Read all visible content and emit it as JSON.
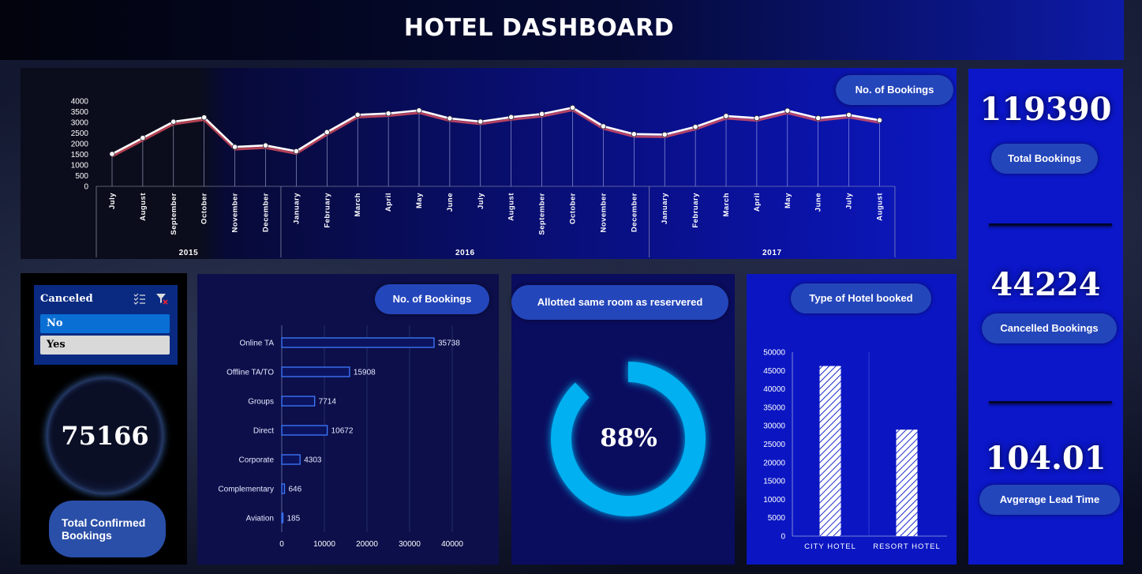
{
  "header": {
    "title": "HOTEL DASHBOARD"
  },
  "line_chart": {
    "pill": "No. of Bookings",
    "chart_data": {
      "type": "line",
      "categories": [
        "July",
        "August",
        "September",
        "October",
        "November",
        "December",
        "January",
        "February",
        "March",
        "April",
        "May",
        "June",
        "July",
        "August",
        "September",
        "October",
        "November",
        "December",
        "January",
        "February",
        "March",
        "April",
        "May",
        "June",
        "July",
        "August"
      ],
      "year_groups": [
        {
          "label": "2015",
          "count": 6
        },
        {
          "label": "2016",
          "count": 12
        },
        {
          "label": "2017",
          "count": 8
        }
      ],
      "values": [
        1517,
        2273,
        3030,
        3232,
        1850,
        1919,
        1648,
        2540,
        3354,
        3419,
        3561,
        3187,
        3037,
        3247,
        3394,
        3690,
        2818,
        2450,
        2430,
        2790,
        3300,
        3200,
        3550,
        3200,
        3350,
        3100
      ],
      "yticks": [
        0,
        500,
        1000,
        1500,
        2000,
        2500,
        3000,
        3500,
        4000
      ],
      "ylim": [
        0,
        4000
      ]
    }
  },
  "kpis": {
    "total_bookings": {
      "value": "119390",
      "label": "Total Bookings"
    },
    "cancelled_bookings": {
      "value": "44224",
      "label": "Cancelled Bookings"
    },
    "lead_time": {
      "value": "104.01",
      "label": "Avgerage Lead Time"
    }
  },
  "slicer": {
    "title": "Canceled",
    "items": [
      {
        "label": "No",
        "selected": true
      },
      {
        "label": "Yes",
        "selected": false
      }
    ],
    "multi_select_icon": "multi-select-icon",
    "clear_filter_icon": "clear-filter-icon"
  },
  "confirmed": {
    "value": "75166",
    "label": "Total Confirmed Bookings"
  },
  "segment_chart": {
    "pill": "No. of Bookings",
    "chart_data": {
      "type": "bar",
      "orientation": "horizontal",
      "categories": [
        "Online TA",
        "Offline TA/TO",
        "Groups",
        "Direct",
        "Corporate",
        "Complementary",
        "Aviation"
      ],
      "values": [
        35738,
        15908,
        7714,
        10672,
        4303,
        646,
        185
      ],
      "xticks": [
        0,
        10000,
        20000,
        30000,
        40000
      ],
      "xlim": [
        0,
        40000
      ]
    }
  },
  "donut": {
    "pill": "Allotted same room as reservered",
    "value_label": "88%",
    "fraction": 0.88
  },
  "hotel_chart": {
    "pill": "Type of Hotel booked",
    "chart_data": {
      "type": "bar",
      "categories": [
        "CITY HOTEL",
        "RESORT HOTEL"
      ],
      "values": [
        46228,
        28938
      ],
      "yticks": [
        0,
        5000,
        10000,
        15000,
        20000,
        25000,
        30000,
        35000,
        40000,
        45000,
        50000
      ],
      "ylim": [
        0,
        50000
      ]
    }
  },
  "colors": {
    "accent": "#2446bb",
    "line": "#ffffff",
    "line_shadow": "#e05060",
    "donut": "#00b0f0",
    "bar_outline": "#3e7bff"
  }
}
